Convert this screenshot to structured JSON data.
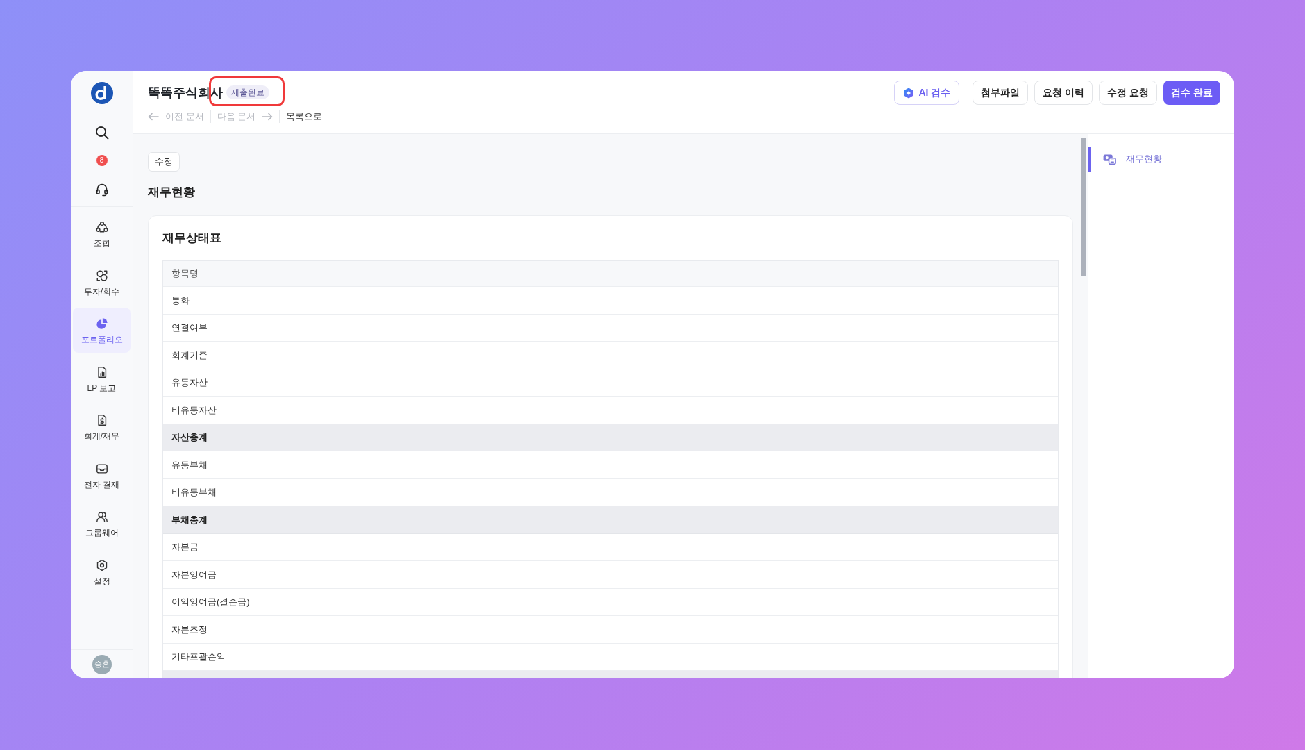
{
  "sidebar": {
    "notification_count": "8",
    "nav": [
      {
        "label": "조합",
        "selected": false
      },
      {
        "label": "투자/회수",
        "selected": false
      },
      {
        "label": "포트폴리오",
        "selected": true
      },
      {
        "label": "LP 보고",
        "selected": false
      },
      {
        "label": "회계/재무",
        "selected": false
      },
      {
        "label": "전자 결재",
        "selected": false
      },
      {
        "label": "그룹웨어",
        "selected": false
      },
      {
        "label": "설정",
        "selected": false
      }
    ],
    "user": {
      "initials": "승훈"
    }
  },
  "header": {
    "title": "똑똑주식회사",
    "status_badge": {
      "text": "제출완료",
      "highlighted": true
    },
    "nav_links": [
      {
        "kind": "prev",
        "label": "이전 문서",
        "disabled": true
      },
      {
        "kind": "next",
        "label": "다음 문서",
        "disabled": true
      },
      {
        "kind": "list",
        "label": "목록으로",
        "disabled": false
      }
    ],
    "actions": [
      {
        "kind": "ai",
        "label": "AI 검수"
      },
      {
        "kind": "default",
        "label": "첨부파일"
      },
      {
        "kind": "default",
        "label": "요청 이력"
      },
      {
        "kind": "default",
        "label": "수정 요청"
      },
      {
        "kind": "primary",
        "label": "검수 완료"
      }
    ]
  },
  "content": {
    "edit_button": "수정",
    "section_title": "재무현황",
    "card": {
      "title": "재무상태표",
      "table": {
        "columns": [
          "항목명"
        ],
        "rows": [
          {
            "kind": "item",
            "label": "통화"
          },
          {
            "kind": "item",
            "label": "연결여부"
          },
          {
            "kind": "item",
            "label": "회계기준"
          },
          {
            "kind": "item",
            "label": "유동자산"
          },
          {
            "kind": "item",
            "label": "비유동자산"
          },
          {
            "kind": "total",
            "label": "자산총계"
          },
          {
            "kind": "item",
            "label": "유동부채"
          },
          {
            "kind": "item",
            "label": "비유동부채"
          },
          {
            "kind": "total",
            "label": "부채총계"
          },
          {
            "kind": "item",
            "label": "자본금"
          },
          {
            "kind": "item",
            "label": "자본잉여금"
          },
          {
            "kind": "item",
            "label": "이익잉여금(결손금)"
          },
          {
            "kind": "item",
            "label": "자본조정"
          },
          {
            "kind": "item",
            "label": "기타포괄손익"
          },
          {
            "kind": "total"
          }
        ]
      }
    }
  },
  "outline": {
    "items": [
      {
        "label": "재무현황",
        "selected": true
      }
    ]
  }
}
